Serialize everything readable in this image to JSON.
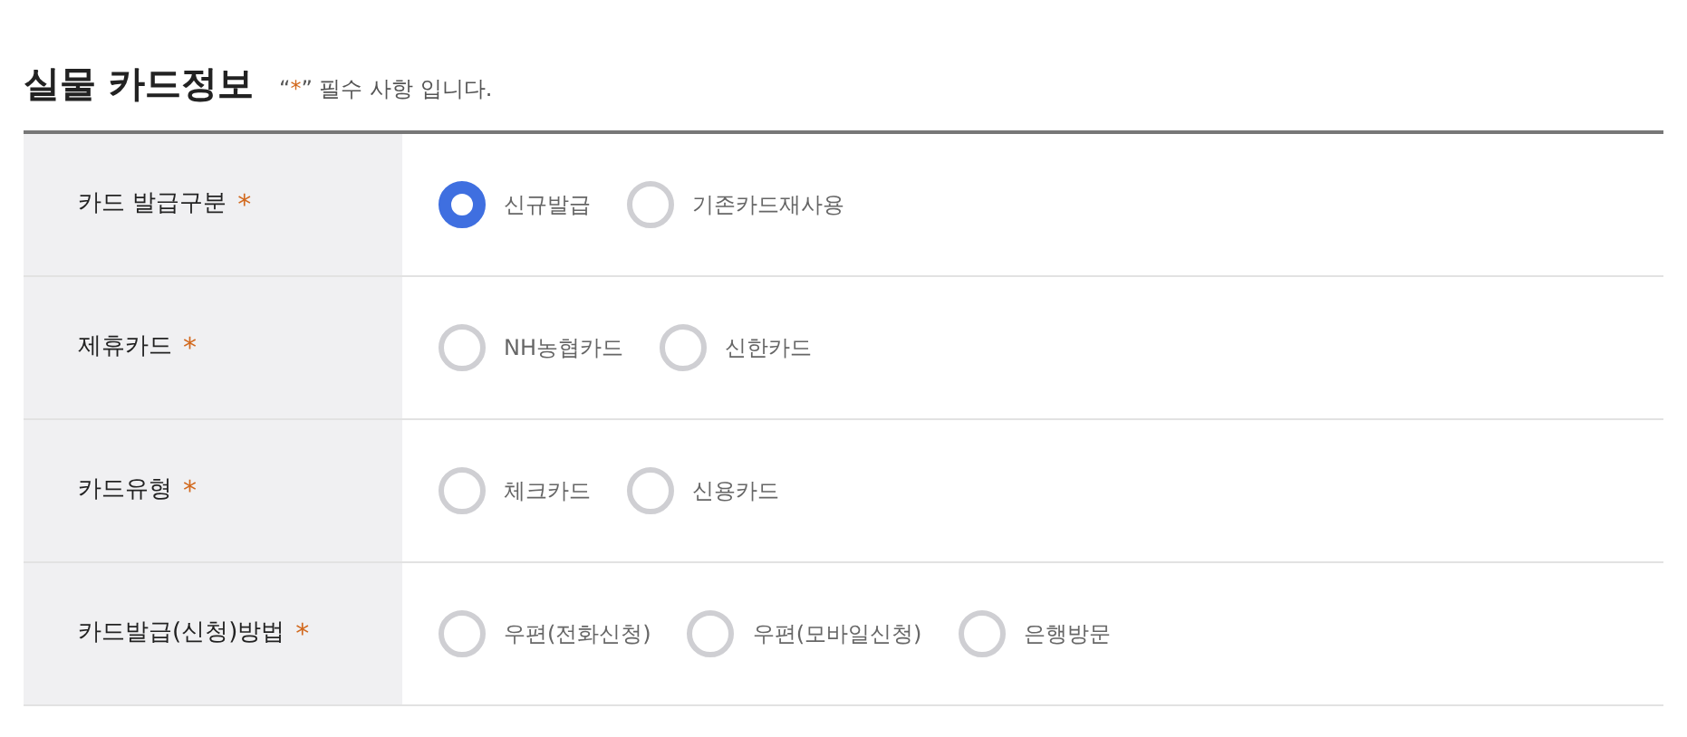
{
  "title": "실물 카드정보",
  "note": {
    "open_quote": "“",
    "mark": "*",
    "close_quote": "”",
    "text": "필수 사항 입니다."
  },
  "rows": [
    {
      "label": "카드 발급구분",
      "mark": "*",
      "options": [
        {
          "label": "신규발급",
          "selected": true
        },
        {
          "label": "기존카드재사용",
          "selected": false
        }
      ]
    },
    {
      "label": "제휴카드",
      "mark": "*",
      "options": [
        {
          "label": "NH농협카드",
          "selected": false
        },
        {
          "label": "신한카드",
          "selected": false
        }
      ]
    },
    {
      "label": "카드유형",
      "mark": "*",
      "options": [
        {
          "label": "체크카드",
          "selected": false
        },
        {
          "label": "신용카드",
          "selected": false
        }
      ]
    },
    {
      "label": "카드발급(신청)방법",
      "mark": "*",
      "options": [
        {
          "label": "우편(전화신청)",
          "selected": false
        },
        {
          "label": "우편(모바일신청)",
          "selected": false
        },
        {
          "label": "은행방문",
          "selected": false
        }
      ]
    }
  ]
}
